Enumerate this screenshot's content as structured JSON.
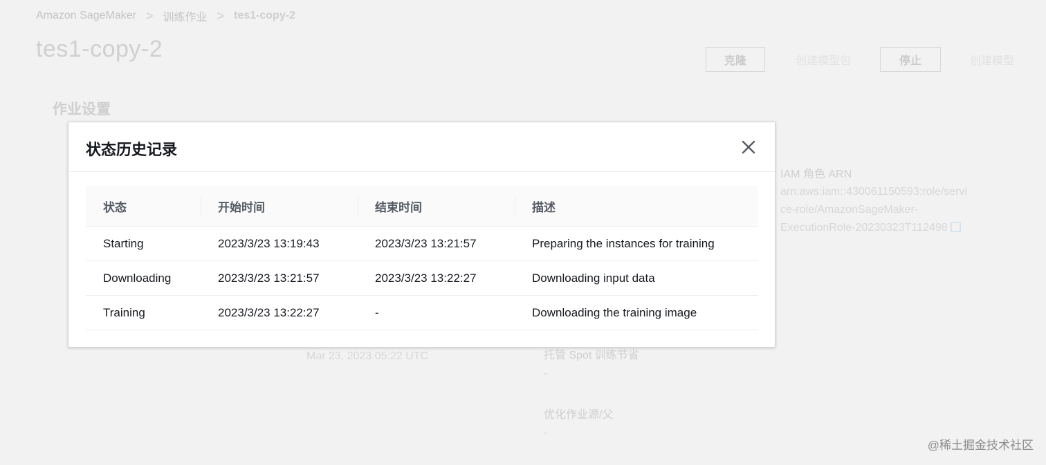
{
  "breadcrumb": {
    "items": [
      "Amazon SageMaker",
      "训练作业",
      "tes1-copy-2"
    ],
    "separator": ">"
  },
  "page": {
    "title": "tes1-copy-2"
  },
  "actions": {
    "clone": "克隆",
    "create_model_package": "创建模型包",
    "stop": "停止",
    "create_model": "创建模型"
  },
  "section": {
    "title": "作业设置"
  },
  "background_fields": {
    "iam_label": "IAM 角色 ARN",
    "iam_value_line1": "arn:aws:iam::430061150593:role/servi",
    "iam_value_line2": "ce-role/AmazonSageMaker-",
    "iam_value_line3": "ExecutionRole-20230323T112498",
    "time_value": "Mar 23, 2023 05:22 UTC",
    "spot_label": "托管 Spot 训练节省",
    "spot_value": "-",
    "tuning_label": "优化作业源/父",
    "tuning_value": "-"
  },
  "modal": {
    "title": "状态历史记录",
    "close_icon": "close-icon",
    "columns": [
      "状态",
      "开始时间",
      "结束时间",
      "描述"
    ],
    "rows": [
      [
        "Starting",
        "2023/3/23 13:19:43",
        "2023/3/23 13:21:57",
        "Preparing the instances for training"
      ],
      [
        "Downloading",
        "2023/3/23 13:21:57",
        "2023/3/23 13:22:27",
        "Downloading input data"
      ],
      [
        "Training",
        "2023/3/23 13:22:27",
        "-",
        "Downloading the training image"
      ]
    ]
  },
  "watermark": "@稀土掘金技术社区"
}
